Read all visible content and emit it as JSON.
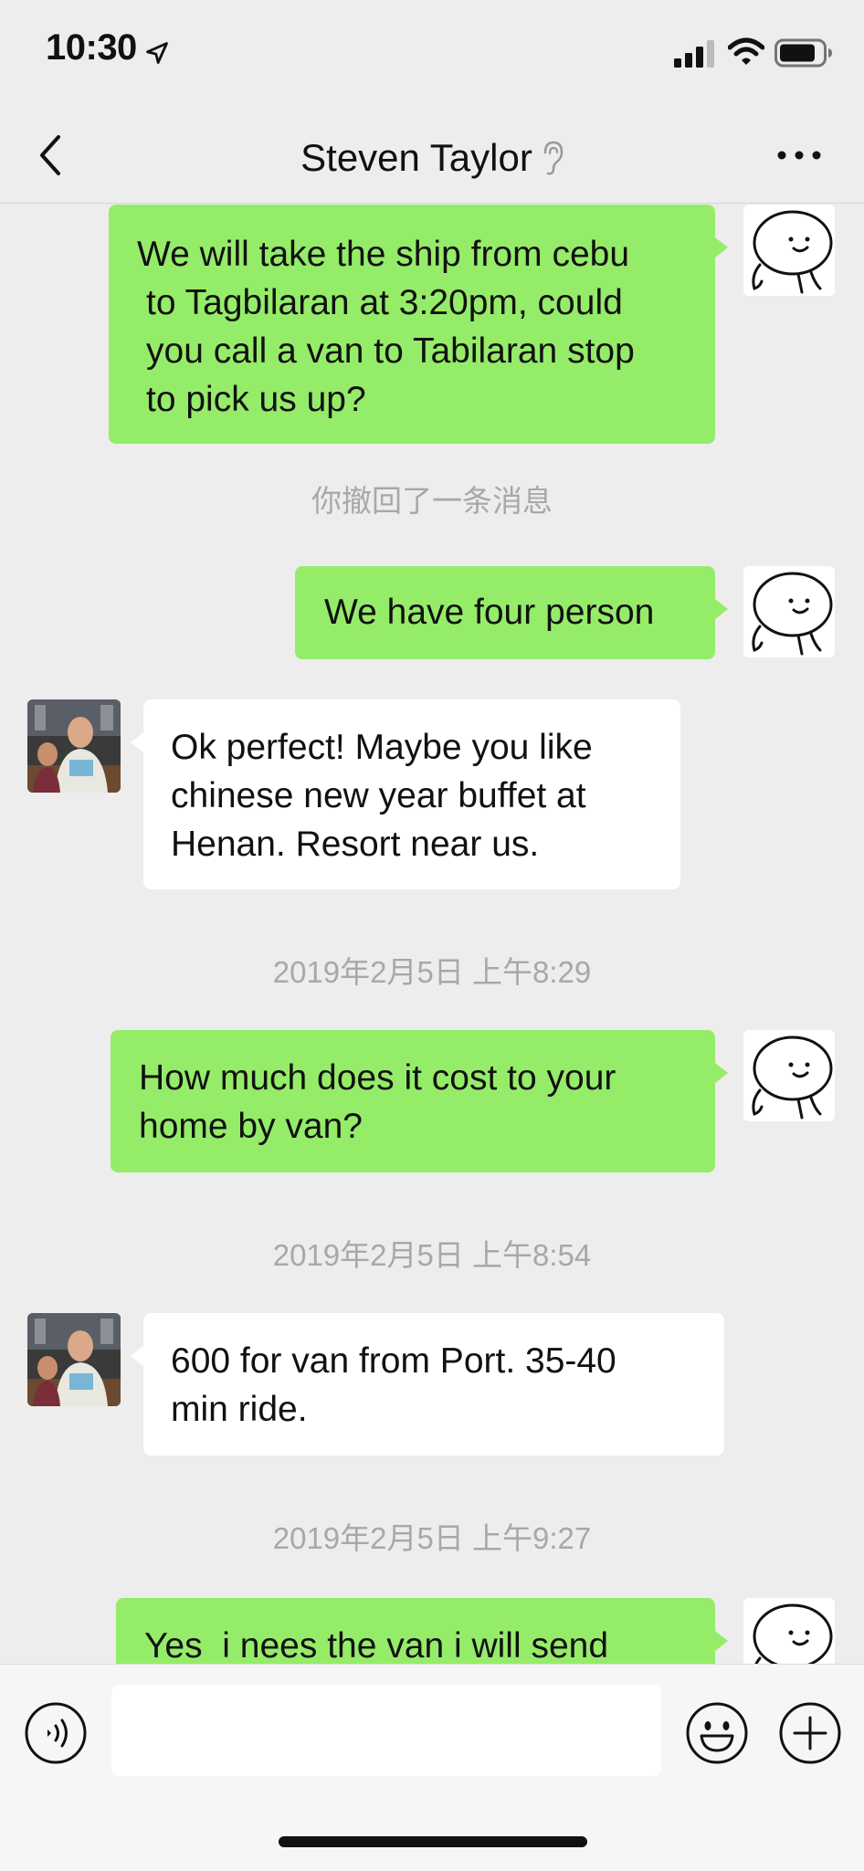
{
  "status_bar": {
    "time": "10:30",
    "location_icon": "location-arrow-icon",
    "signal_icon": "cellular-signal-icon",
    "wifi_icon": "wifi-icon",
    "battery_icon": "battery-icon"
  },
  "nav": {
    "back_icon": "chevron-left-icon",
    "title": "Steven Taylor",
    "earpiece_icon": "ear-icon",
    "more_icon": "more-dots-icon"
  },
  "messages": [
    {
      "type": "me",
      "lines": [
        "We will take the ship from cebu",
        "to Tagbilaran at 3:20pm, could",
        "you call a van to Tabilaran stop",
        "to pick us up?"
      ]
    },
    {
      "type": "system",
      "text": "你撤回了一条消息"
    },
    {
      "type": "me",
      "lines": [
        "We have four person"
      ]
    },
    {
      "type": "them",
      "lines": [
        "Ok perfect! Maybe you like",
        "chinese new year buffet at",
        "Henan. Resort near us."
      ]
    },
    {
      "type": "system",
      "text": "2019年2月5日 上午8:29"
    },
    {
      "type": "me",
      "lines": [
        "How much does it cost to your",
        "home by van?"
      ]
    },
    {
      "type": "system",
      "text": "2019年2月5日 上午8:54"
    },
    {
      "type": "them",
      "lines": [
        "600 for van from Port. 35-40",
        "min ride."
      ]
    },
    {
      "type": "system",
      "text": "2019年2月5日 上午9:27"
    },
    {
      "type": "me",
      "lines": [
        "Yes  i nees the van i will send"
      ]
    }
  ],
  "input_bar": {
    "voice_icon": "voice-input-icon",
    "input_value": "",
    "emoji_icon": "emoji-icon",
    "plus_icon": "plus-icon"
  }
}
